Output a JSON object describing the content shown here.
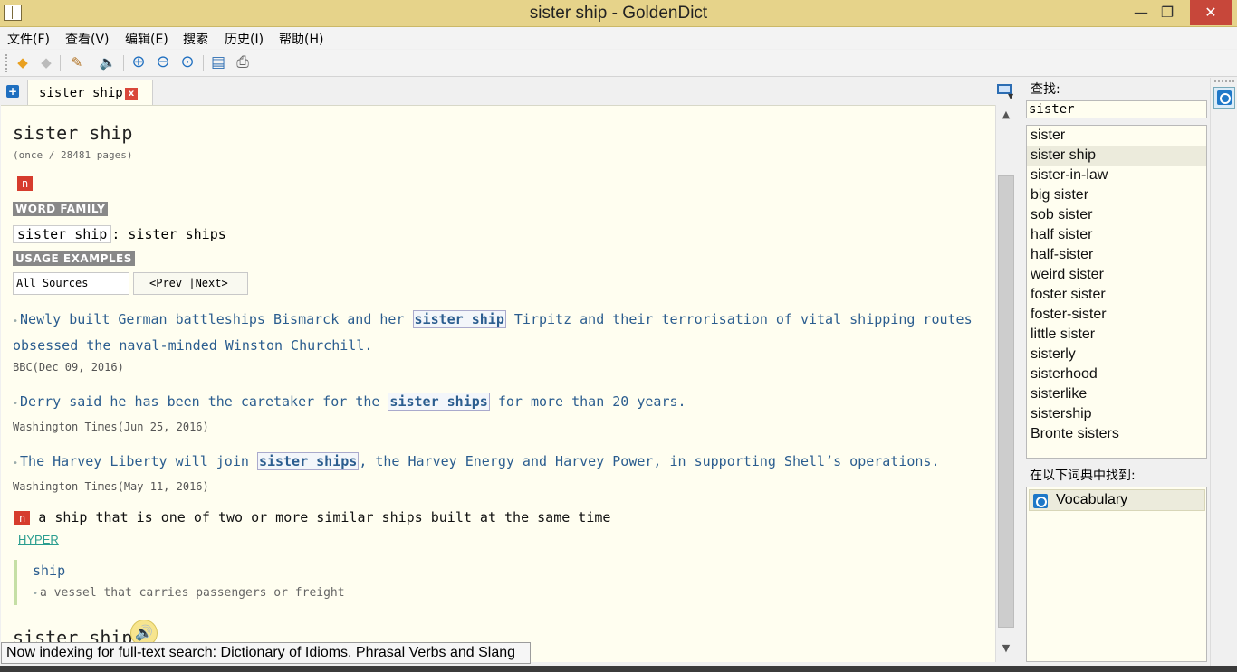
{
  "window": {
    "title": "sister ship - GoldenDict",
    "minimize": "—",
    "maximize": "❐",
    "close": "✕"
  },
  "menu": [
    "文件(F)",
    "查看(V)",
    "编辑(E)",
    "搜索",
    "历史(I)",
    "帮助(H)"
  ],
  "toolbar": {
    "back": "◆",
    "forward": "◆",
    "scan": "✎",
    "pronounce": "🔈",
    "zoom_in": "⊕",
    "zoom_out": "⊖",
    "zoom_reset": "⊙",
    "save": "▤",
    "print": "⎙"
  },
  "tab": {
    "new": "+",
    "label": "sister ship",
    "close": "x"
  },
  "article": {
    "headword": "sister ship",
    "frequency": "(once / 28481 pages)",
    "pos": "n",
    "word_family_label": "WORD FAMILY",
    "word_family_head": "sister ship",
    "word_family_rest": ": sister ships",
    "usage_label": "USAGE EXAMPLES",
    "source_select": "All Sources",
    "pager": "<Prev |Next>",
    "examples": [
      {
        "pre": "Newly built German battleships Bismarck and her ",
        "hl": "sister ship",
        "post": " Tirpitz and their terrorisation of vital shipping routes",
        "line2": "obsessed the naval-minded Winston Churchill.",
        "source": "BBC(Dec 09, 2016)"
      },
      {
        "pre": "Derry said he has been the caretaker for the ",
        "hl": "sister ships",
        "post": " for more than 20 years.",
        "source": "Washington Times(Jun 25, 2016)"
      },
      {
        "pre": "The Harvey Liberty will join ",
        "hl": "sister ships",
        "post": ", the Harvey Energy and Harvey Power, in supporting Shell’s operations.",
        "source": "Washington Times(May 11, 2016)"
      }
    ],
    "definition": "a ship that is one of two or more similar ships built at the same time",
    "hyper": "HYPER",
    "synonym_word": "ship",
    "synonym_def": "a vessel that carries passengers or freight",
    "second_headword": "sister ship",
    "speaker": "🔊"
  },
  "scroll": {
    "up": "▲",
    "down": "▼"
  },
  "status": "Now indexing for full-text search: Dictionary of Idioms, Phrasal Verbs and Slang",
  "right_pane": {
    "lookup_label": "查找:",
    "search_value": "sister",
    "results": [
      "sister",
      "sister ship",
      "sister-in-law",
      "big sister",
      "sob sister",
      "half sister",
      "half-sister",
      "weird sister",
      "foster sister",
      "foster-sister",
      "little sister",
      "sisterly",
      "sisterhood",
      "sisterlike",
      "sistership",
      "Bronte sisters"
    ],
    "selected_result": "sister ship",
    "found_label": "在以下词典中找到:",
    "found_dicts": [
      "Vocabulary"
    ]
  },
  "colors": {
    "titlebar": "#e6d38a",
    "article_bg": "#fffef0",
    "badge": "#d63c2d",
    "example_text": "#2b5d8f"
  }
}
